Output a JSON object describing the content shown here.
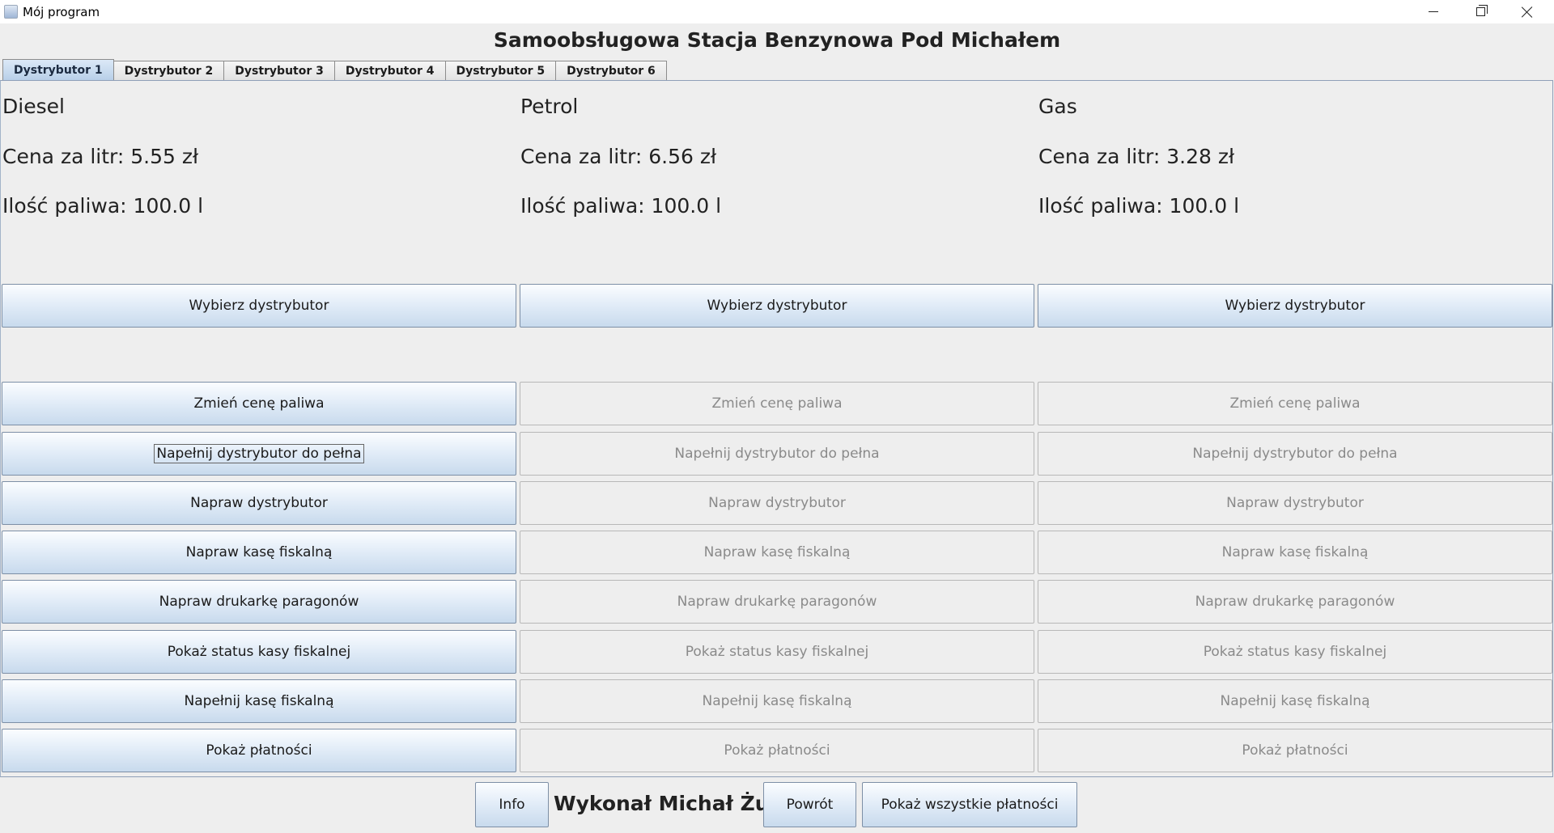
{
  "window": {
    "title": "Mój program",
    "icon": "java-cup-icon"
  },
  "heading": "Samoobsługowa Stacja Benzynowa Pod Michałem",
  "tabs": [
    {
      "label": "Dystrybutor 1",
      "active": true
    },
    {
      "label": "Dystrybutor 2",
      "active": false
    },
    {
      "label": "Dystrybutor 3",
      "active": false
    },
    {
      "label": "Dystrybutor 4",
      "active": false
    },
    {
      "label": "Dystrybutor 5",
      "active": false
    },
    {
      "label": "Dystrybutor 6",
      "active": false
    }
  ],
  "columns": [
    {
      "fuel": "Diesel",
      "price": "Cena za litr: 5.55 zł",
      "amount": "Ilość paliwa: 100.0 l",
      "select_label": "Wybierz dystrybutor",
      "enabled": true
    },
    {
      "fuel": "Petrol",
      "price": "Cena za litr: 6.56 zł",
      "amount": "Ilość paliwa: 100.0 l",
      "select_label": "Wybierz dystrybutor",
      "enabled": false
    },
    {
      "fuel": "Gas",
      "price": "Cena za litr: 3.28 zł",
      "amount": "Ilość paliwa: 100.0 l",
      "select_label": "Wybierz dystrybutor",
      "enabled": false
    }
  ],
  "actions": [
    "Zmień cenę paliwa",
    "Napełnij dystrybutor do pełna",
    "Napraw dystrybutor",
    "Napraw kasę fiskalną",
    "Napraw drukarkę paragonów",
    "Pokaż status kasy fiskalnej",
    "Napełnij kasę fiskalną",
    "Pokaż płatności"
  ],
  "footer": {
    "info_label": "Info",
    "author": "Wykonał Michał Żuk",
    "back_label": "Powrót",
    "all_payments_label": "Pokaż wszystkie płatności"
  },
  "colors": {
    "button_gradient_top": "#fbfdff",
    "button_gradient_bottom": "#c8daed",
    "disabled_text": "#8a8a8a",
    "background": "#eeeeee"
  }
}
